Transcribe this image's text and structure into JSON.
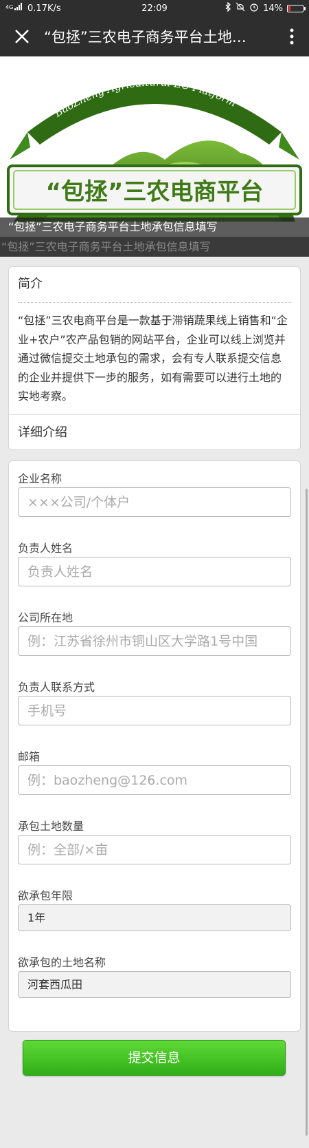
{
  "status_bar": {
    "network": "4G",
    "speed": "0.17K/s",
    "time": "22:09",
    "battery": "14%",
    "battery_level": 0.14,
    "icons": [
      "signal-icon",
      "bluetooth-icon",
      "mute-icon",
      "alarm-icon",
      "battery-icon"
    ]
  },
  "title_bar": {
    "title": "“包拯”三农电子商务平台土地…",
    "close_icon": "close-icon",
    "more_icon": "more-vertical-icon"
  },
  "banner": {
    "logo_arc_text": "BaoZheng Agricultural EC Platform",
    "logo_main_text": "“包拯”三农电商平台",
    "caption": "“包拯”三农电子商务平台土地承包信息填写",
    "colors": {
      "dark_green": "#2e6b12",
      "light_green": "#8cc63f"
    }
  },
  "sub_caption": "“包拯”三农电子商务平台土地承包信息填写",
  "intro": {
    "heading": "简介",
    "text": "“包拯”三农电商平台是一款基于滞销蔬果线上销售和“企业+农户”农产品包销的网站平台，企业可以线上浏览并通过微信提交土地承包的需求，会有专人联系提交信息的企业并提供下一步的服务，如有需要可以进行土地的实地考察。",
    "more_label": "详细介绍"
  },
  "form": {
    "fields": [
      {
        "label": "企业名称",
        "placeholder": "×××公司/个体户"
      },
      {
        "label": "负责人姓名",
        "placeholder": "负责人姓名"
      },
      {
        "label": "公司所在地",
        "placeholder": "例：江苏省徐州市铜山区大学路1号中国"
      },
      {
        "label": "负责人联系方式",
        "placeholder": "手机号"
      },
      {
        "label": "邮箱",
        "placeholder": "例：baozheng@126.com"
      },
      {
        "label": "承包土地数量",
        "placeholder": "例：全部/×亩"
      }
    ],
    "selects": [
      {
        "label": "欲承包年限",
        "value": "1年"
      },
      {
        "label": "欲承包的土地名称",
        "value": "河套西瓜田"
      }
    ]
  },
  "submit_label": "提交信息",
  "colors": {
    "submit_green": "#3cbf1f",
    "bar": "#2e2e2e"
  }
}
